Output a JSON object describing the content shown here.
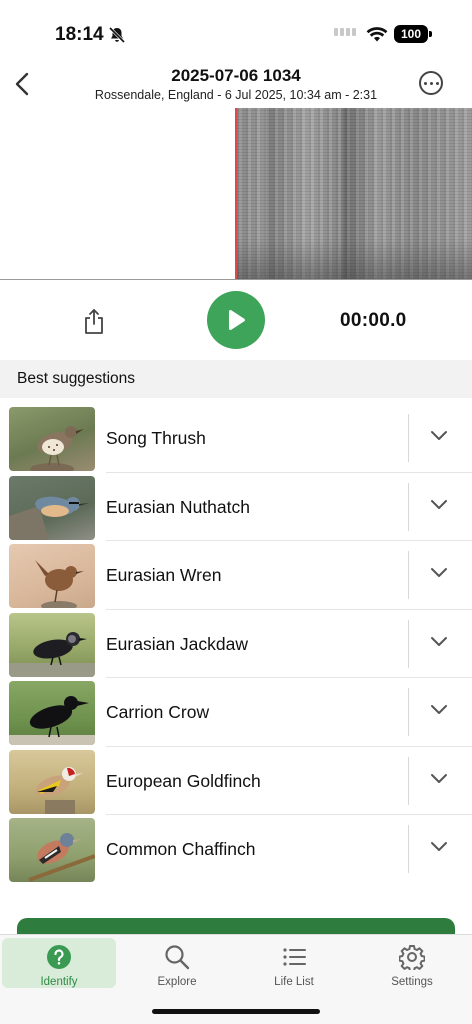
{
  "status_bar": {
    "time": "18:14",
    "battery": "100"
  },
  "header": {
    "title": "2025-07-06 1034",
    "subtitle": "Rossendale, England - 6 Jul 2025, 10:34 am - 2:31"
  },
  "player": {
    "timer": "00:00.0",
    "accent": "#3ea45a"
  },
  "suggestions": {
    "heading": "Best suggestions",
    "items": [
      {
        "name": "Song Thrush"
      },
      {
        "name": "Eurasian Nuthatch"
      },
      {
        "name": "Eurasian Wren"
      },
      {
        "name": "Eurasian Jackdaw"
      },
      {
        "name": "Carrion Crow"
      },
      {
        "name": "European Goldfinch"
      },
      {
        "name": "Common Chaffinch"
      }
    ]
  },
  "tabs": [
    {
      "label": "Identify",
      "icon": "question-circle-icon",
      "active": true
    },
    {
      "label": "Explore",
      "icon": "search-icon",
      "active": false
    },
    {
      "label": "Life List",
      "icon": "list-icon",
      "active": false
    },
    {
      "label": "Settings",
      "icon": "gear-icon",
      "active": false
    }
  ]
}
